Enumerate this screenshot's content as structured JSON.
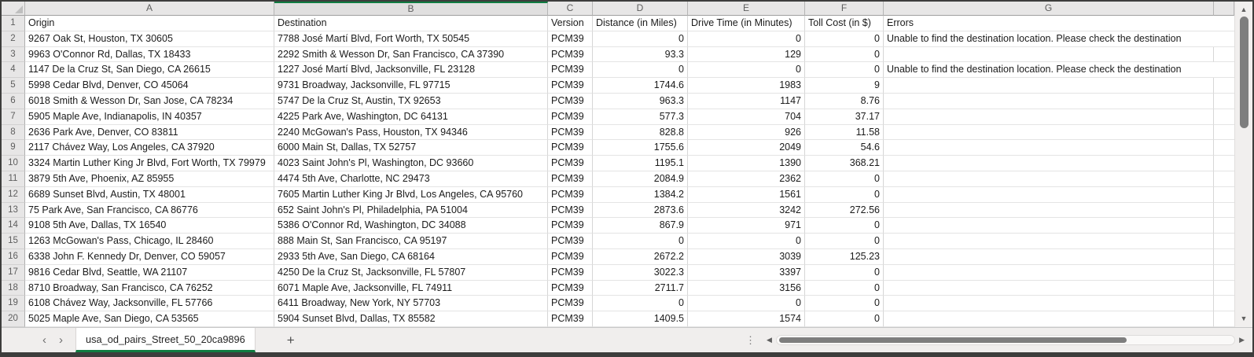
{
  "sheet": {
    "selected_column": "B",
    "columns": [
      "A",
      "B",
      "C",
      "D",
      "E",
      "F",
      "G"
    ],
    "headers": [
      "Origin",
      "Destination",
      "Version",
      "Distance (in Miles)",
      "Drive Time (in Minutes)",
      "Toll Cost (in $)",
      "Errors"
    ],
    "rows": [
      [
        "9267 Oak St, Houston, TX 30605",
        "7788 José Martí Blvd, Fort Worth, TX 50545",
        "PCM39",
        "0",
        "0",
        "0",
        "Unable to find the destination location. Please check the destination"
      ],
      [
        "9963 O'Connor Rd, Dallas, TX 18433",
        "2292 Smith & Wesson Dr, San Francisco, CA 37390",
        "PCM39",
        "93.3",
        "129",
        "0",
        ""
      ],
      [
        "1147 De la Cruz St, San Diego, CA 26615",
        "1227 José Martí Blvd, Jacksonville, FL 23128",
        "PCM39",
        "0",
        "0",
        "0",
        "Unable to find the destination location. Please check the destination"
      ],
      [
        "5998 Cedar Blvd, Denver, CO 45064",
        "9731 Broadway, Jacksonville, FL 97715",
        "PCM39",
        "1744.6",
        "1983",
        "9",
        ""
      ],
      [
        "6018 Smith & Wesson Dr, San Jose, CA 78234",
        "5747 De la Cruz St, Austin, TX 92653",
        "PCM39",
        "963.3",
        "1147",
        "8.76",
        ""
      ],
      [
        "5905 Maple Ave, Indianapolis, IN 40357",
        "4225 Park Ave, Washington, DC 64131",
        "PCM39",
        "577.3",
        "704",
        "37.17",
        ""
      ],
      [
        "2636 Park Ave, Denver, CO 83811",
        "2240 McGowan's Pass, Houston, TX 94346",
        "PCM39",
        "828.8",
        "926",
        "11.58",
        ""
      ],
      [
        "2117 Chávez Way, Los Angeles, CA 37920",
        "6000 Main St, Dallas, TX 52757",
        "PCM39",
        "1755.6",
        "2049",
        "54.6",
        ""
      ],
      [
        "3324 Martin Luther King Jr Blvd, Fort Worth, TX 79979",
        "4023 Saint John's Pl, Washington, DC 93660",
        "PCM39",
        "1195.1",
        "1390",
        "368.21",
        ""
      ],
      [
        "3879 5th Ave, Phoenix, AZ 85955",
        "4474 5th Ave, Charlotte, NC 29473",
        "PCM39",
        "2084.9",
        "2362",
        "0",
        ""
      ],
      [
        "6689 Sunset Blvd, Austin, TX 48001",
        "7605 Martin Luther King Jr Blvd, Los Angeles, CA 95760",
        "PCM39",
        "1384.2",
        "1561",
        "0",
        ""
      ],
      [
        "75 Park Ave, San Francisco, CA 86776",
        "652 Saint John's Pl, Philadelphia, PA 51004",
        "PCM39",
        "2873.6",
        "3242",
        "272.56",
        ""
      ],
      [
        "9108 5th Ave, Dallas, TX 16540",
        "5386 O'Connor Rd, Washington, DC 34088",
        "PCM39",
        "867.9",
        "971",
        "0",
        ""
      ],
      [
        "1263 McGowan's Pass, Chicago, IL 28460",
        "888 Main St, San Francisco, CA 95197",
        "PCM39",
        "0",
        "0",
        "0",
        ""
      ],
      [
        "6338 John F. Kennedy Dr, Denver, CO 59057",
        "2933 5th Ave, San Diego, CA 68164",
        "PCM39",
        "2672.2",
        "3039",
        "125.23",
        ""
      ],
      [
        "9816 Cedar Blvd, Seattle, WA 21107",
        "4250 De la Cruz St, Jacksonville, FL 57807",
        "PCM39",
        "3022.3",
        "3397",
        "0",
        ""
      ],
      [
        "8710 Broadway, San Francisco, CA 76252",
        "6071 Maple Ave, Jacksonville, FL 74911",
        "PCM39",
        "2711.7",
        "3156",
        "0",
        ""
      ],
      [
        "6108 Chávez Way, Jacksonville, FL 57766",
        "6411 Broadway, New York, NY 57703",
        "PCM39",
        "0",
        "0",
        "0",
        ""
      ],
      [
        "5025 Maple Ave, San Diego, CA 53565",
        "5904 Sunset Blvd, Dallas, TX 85582",
        "PCM39",
        "1409.5",
        "1574",
        "0",
        ""
      ]
    ]
  },
  "tab_bar": {
    "active_sheet": "usa_od_pairs_Street_50_20ca9896",
    "icons": {
      "prev": "‹",
      "next": "›",
      "add": "+",
      "handle": "⋮",
      "left": "◀",
      "right": "▶",
      "up": "▲",
      "down": "▼"
    }
  },
  "colors": {
    "accent_green": "#107C41",
    "header_bg": "#e7e6e6",
    "gridline": "#d6d6d6"
  }
}
